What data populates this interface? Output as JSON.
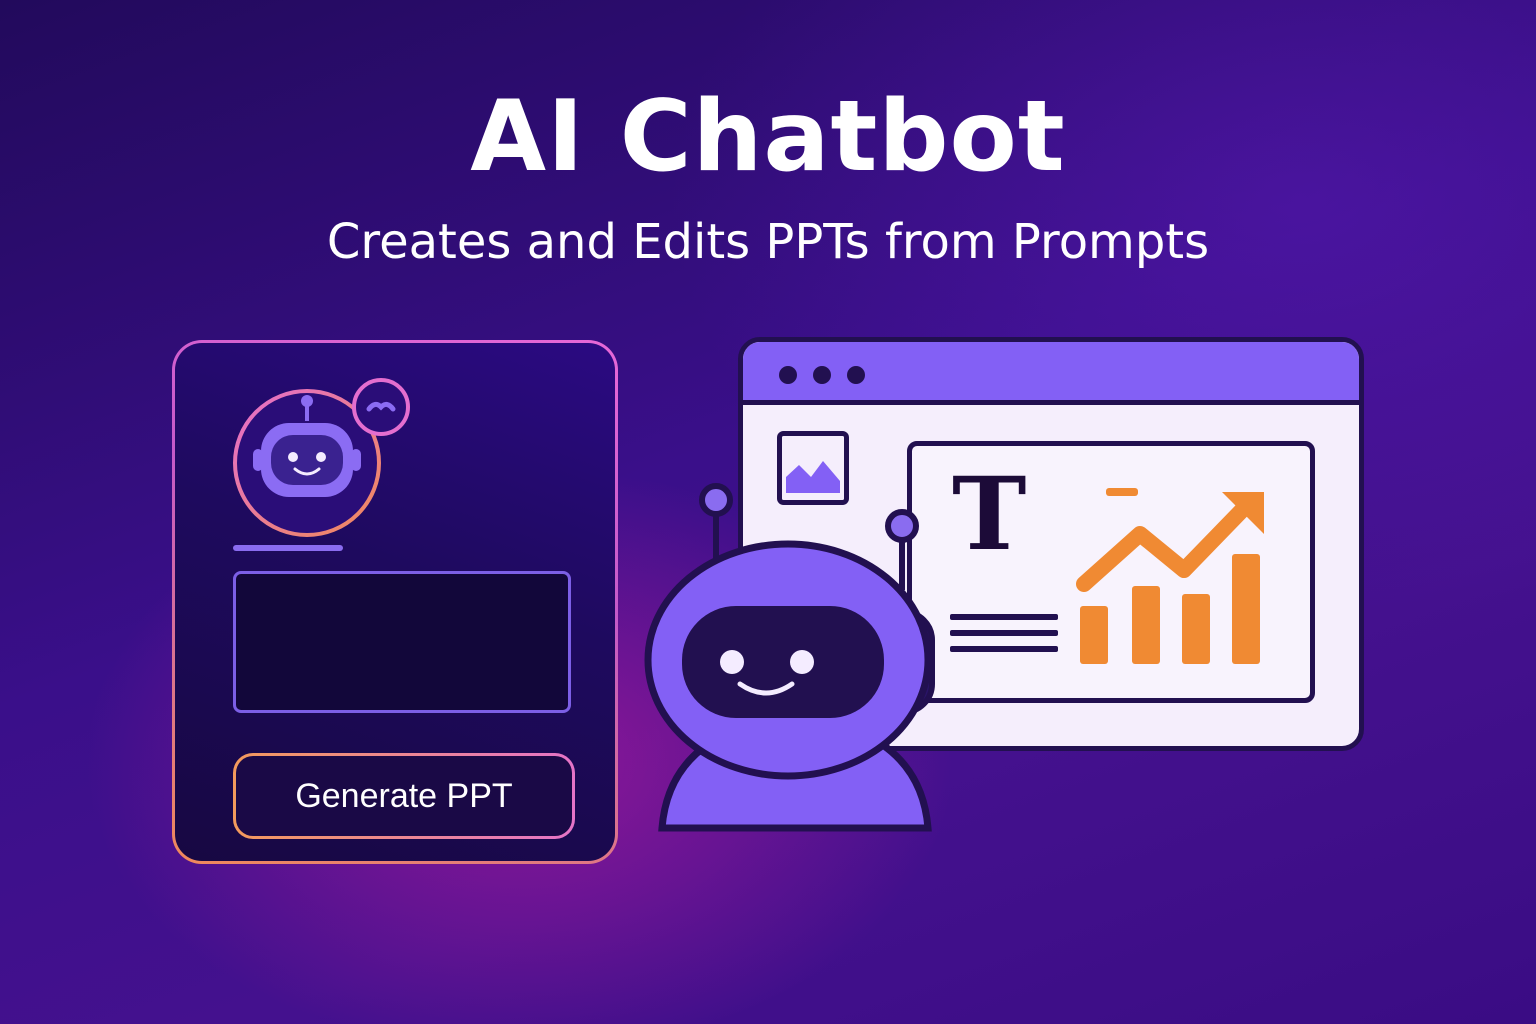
{
  "hero": {
    "title": "AI Chatbot",
    "subtitle": "Creates and Edits PPTs from Prompts"
  },
  "chat_panel": {
    "button_label": "Generate PPT",
    "avatar_icon": "robot-icon",
    "badge_icon": "wave-icon"
  },
  "slide_window": {
    "titlebar_icons": [
      "window-dot-icon",
      "window-dot-icon",
      "window-dot-icon"
    ],
    "image_icon": "image-icon",
    "text_icon_glyph": "T",
    "chart_icon": "trending-bar-chart-icon"
  },
  "colors": {
    "accent_purple": "#8360f5",
    "accent_orange": "#f08a33",
    "dark_navy": "#221050",
    "panel_gradient_pink": "#e768d8",
    "panel_gradient_orange": "#f08a5a"
  }
}
